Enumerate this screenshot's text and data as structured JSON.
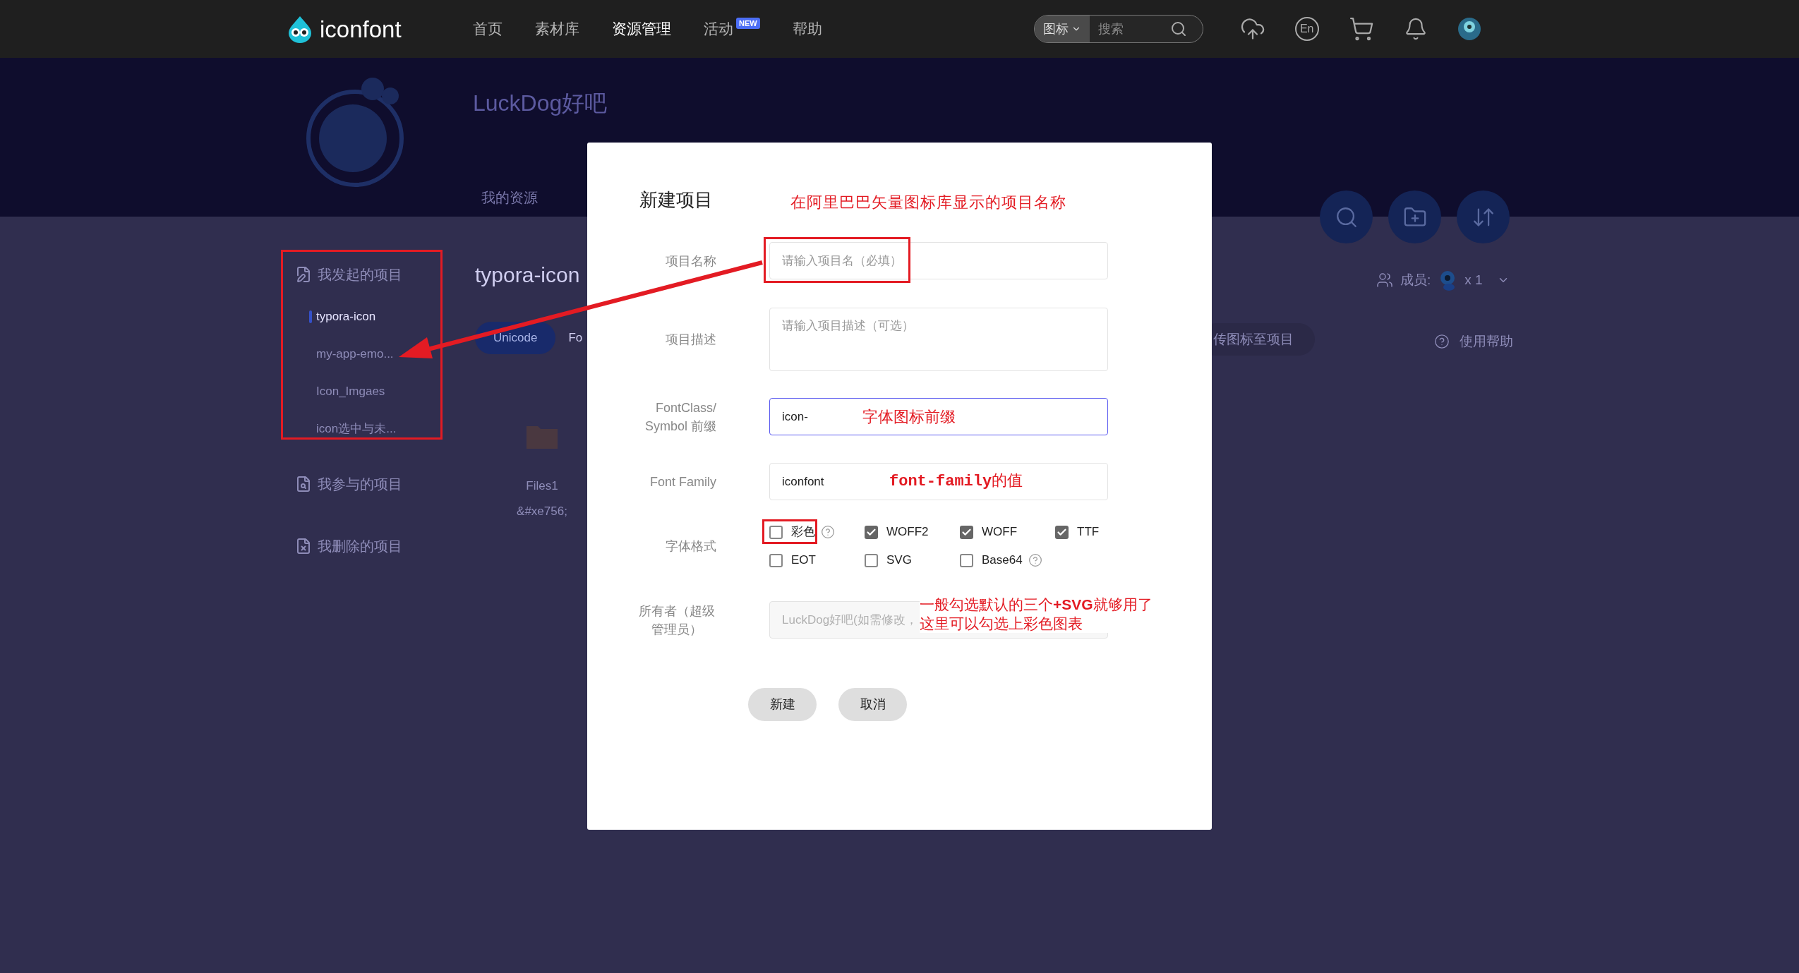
{
  "nav": {
    "logo": "iconfont",
    "items": [
      {
        "label": "首页",
        "selected": false
      },
      {
        "label": "素材库",
        "selected": false
      },
      {
        "label": "资源管理",
        "selected": true
      },
      {
        "label": "活动",
        "selected": false,
        "badge": "NEW"
      },
      {
        "label": "帮助",
        "selected": false
      }
    ],
    "search": {
      "scope": "图标",
      "placeholder": "搜索"
    },
    "language": "En"
  },
  "profile": {
    "name": "LuckDog好吧",
    "tabs": [
      "我的资源"
    ]
  },
  "sidebar": {
    "highlighted": true,
    "groups": [
      {
        "label": "我发起的项目",
        "kind": "started",
        "children": [
          {
            "label": "typora-icon",
            "selected": true
          },
          {
            "label": "my-app-emo...",
            "selected": false
          },
          {
            "label": "Icon_Imgaes",
            "selected": false
          },
          {
            "label": "icon选中与未...",
            "selected": false
          }
        ]
      },
      {
        "label": "我参与的项目",
        "kind": "joined"
      },
      {
        "label": "我删除的项目",
        "kind": "deleted"
      }
    ]
  },
  "project": {
    "title": "typora-icon",
    "tabs": [
      {
        "label": "Unicode",
        "selected": true
      },
      {
        "label": "Fo",
        "selected": false
      }
    ],
    "upload": "传图标至项目",
    "members_label": "成员:",
    "members_count": "x 1",
    "help": "使用帮助",
    "icons": [
      {
        "name": "Files1",
        "code": "&#xe756;"
      }
    ]
  },
  "dialog": {
    "title": "新建项目",
    "note": "在阿里巴巴矢量图标库显示的项目名称",
    "fields": [
      {
        "label": "项目名称",
        "kind": "input",
        "placeholder": "请输入项目名（必填）",
        "highlighted": true,
        "focused": false
      },
      {
        "label": "项目描述",
        "kind": "textarea",
        "placeholder": "请输入项目描述（可选）",
        "highlighted": false,
        "focused": false
      },
      {
        "label": "FontClass/ Symbol 前缀",
        "kind": "input",
        "value": "icon-",
        "note": "字体图标前缀",
        "note_code": false,
        "highlighted": false,
        "focused": true
      },
      {
        "label": "Font Family",
        "kind": "input",
        "value": "iconfont",
        "note": "**font-family**的值",
        "note_code": true,
        "highlighted": false,
        "focused": false
      }
    ],
    "formats": {
      "label": "字体格式",
      "options": [
        {
          "label": "彩色",
          "checked": false,
          "help": true,
          "highlighted": true
        },
        {
          "label": "WOFF2",
          "checked": true,
          "help": false,
          "highlighted": false
        },
        {
          "label": "WOFF",
          "checked": true,
          "help": false,
          "highlighted": false
        },
        {
          "label": "TTF",
          "checked": true,
          "help": false,
          "highlighted": false
        },
        {
          "label": "EOT",
          "checked": false,
          "help": false,
          "highlighted": false
        },
        {
          "label": "SVG",
          "checked": false,
          "help": false,
          "highlighted": false
        },
        {
          "label": "Base64",
          "checked": false,
          "help": true,
          "highlighted": false
        }
      ]
    },
    "owner": {
      "label": "所有者（超级管理员）",
      "kind": "readonly",
      "value": "LuckDog好吧(如需修改，",
      "note_lines": [
        "一般勾选默认的三个**+SVG**就够用了",
        "这里可以勾选上彩色图表"
      ]
    },
    "buttons": [
      "新建",
      "取消"
    ]
  }
}
